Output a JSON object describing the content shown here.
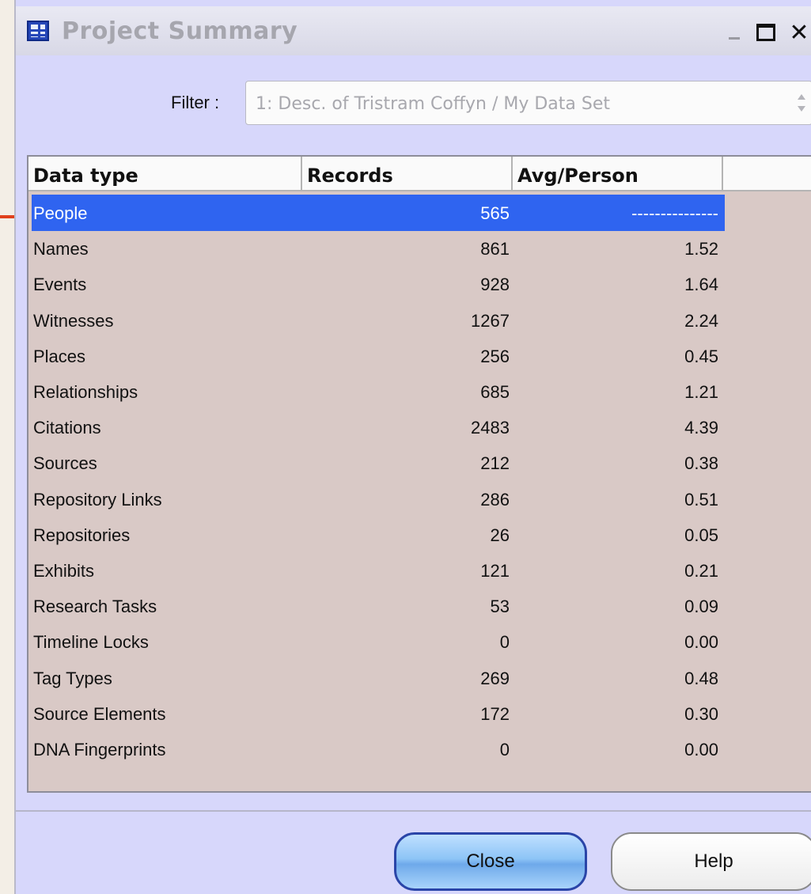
{
  "window": {
    "title": "Project Summary",
    "title_icon": "table-grid-icon"
  },
  "filter": {
    "label": "Filter :",
    "value": "1:  Desc. of Tristram Coffyn / My Data Set"
  },
  "table": {
    "columns": [
      "Data type",
      "Records",
      "Avg/Person"
    ],
    "rows": [
      {
        "type": "People",
        "records": "565",
        "avg": "---------------"
      },
      {
        "type": "Names",
        "records": "861",
        "avg": "1.52"
      },
      {
        "type": "Events",
        "records": "928",
        "avg": "1.64"
      },
      {
        "type": "Witnesses",
        "records": "1267",
        "avg": "2.24"
      },
      {
        "type": "Places",
        "records": "256",
        "avg": "0.45"
      },
      {
        "type": "Relationships",
        "records": "685",
        "avg": "1.21"
      },
      {
        "type": "Citations",
        "records": "2483",
        "avg": "4.39"
      },
      {
        "type": "Sources",
        "records": "212",
        "avg": "0.38"
      },
      {
        "type": "Repository Links",
        "records": "286",
        "avg": "0.51"
      },
      {
        "type": "Repositories",
        "records": "26",
        "avg": "0.05"
      },
      {
        "type": "Exhibits",
        "records": "121",
        "avg": "0.21"
      },
      {
        "type": "Research Tasks",
        "records": "53",
        "avg": "0.09"
      },
      {
        "type": "Timeline Locks",
        "records": "0",
        "avg": "0.00"
      },
      {
        "type": "Tag Types",
        "records": "269",
        "avg": "0.48"
      },
      {
        "type": "Source Elements",
        "records": "172",
        "avg": "0.30"
      },
      {
        "type": "DNA Fingerprints",
        "records": "0",
        "avg": "0.00"
      }
    ],
    "selected_row": "People"
  },
  "buttons": {
    "close": "Close",
    "help": "Help"
  },
  "colors": {
    "window_bg": "#d7d7fb",
    "table_bg": "#d9c9c6",
    "selection": "#2f64f0",
    "annotation_arrow": "#e0401c"
  }
}
